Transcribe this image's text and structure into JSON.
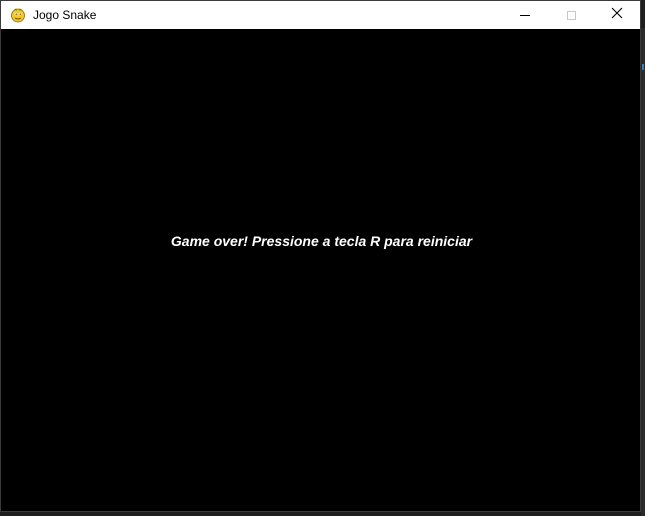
{
  "window": {
    "title": "Jogo Snake",
    "icon": "pygame-snake-icon",
    "controls": {
      "minimize": "minimize-icon",
      "maximize": "maximize-icon",
      "close": "close-icon"
    }
  },
  "game": {
    "message": "Game over! Pressione a tecla R para reiniciar",
    "background_color": "#000000",
    "text_color": "#ffffff"
  }
}
